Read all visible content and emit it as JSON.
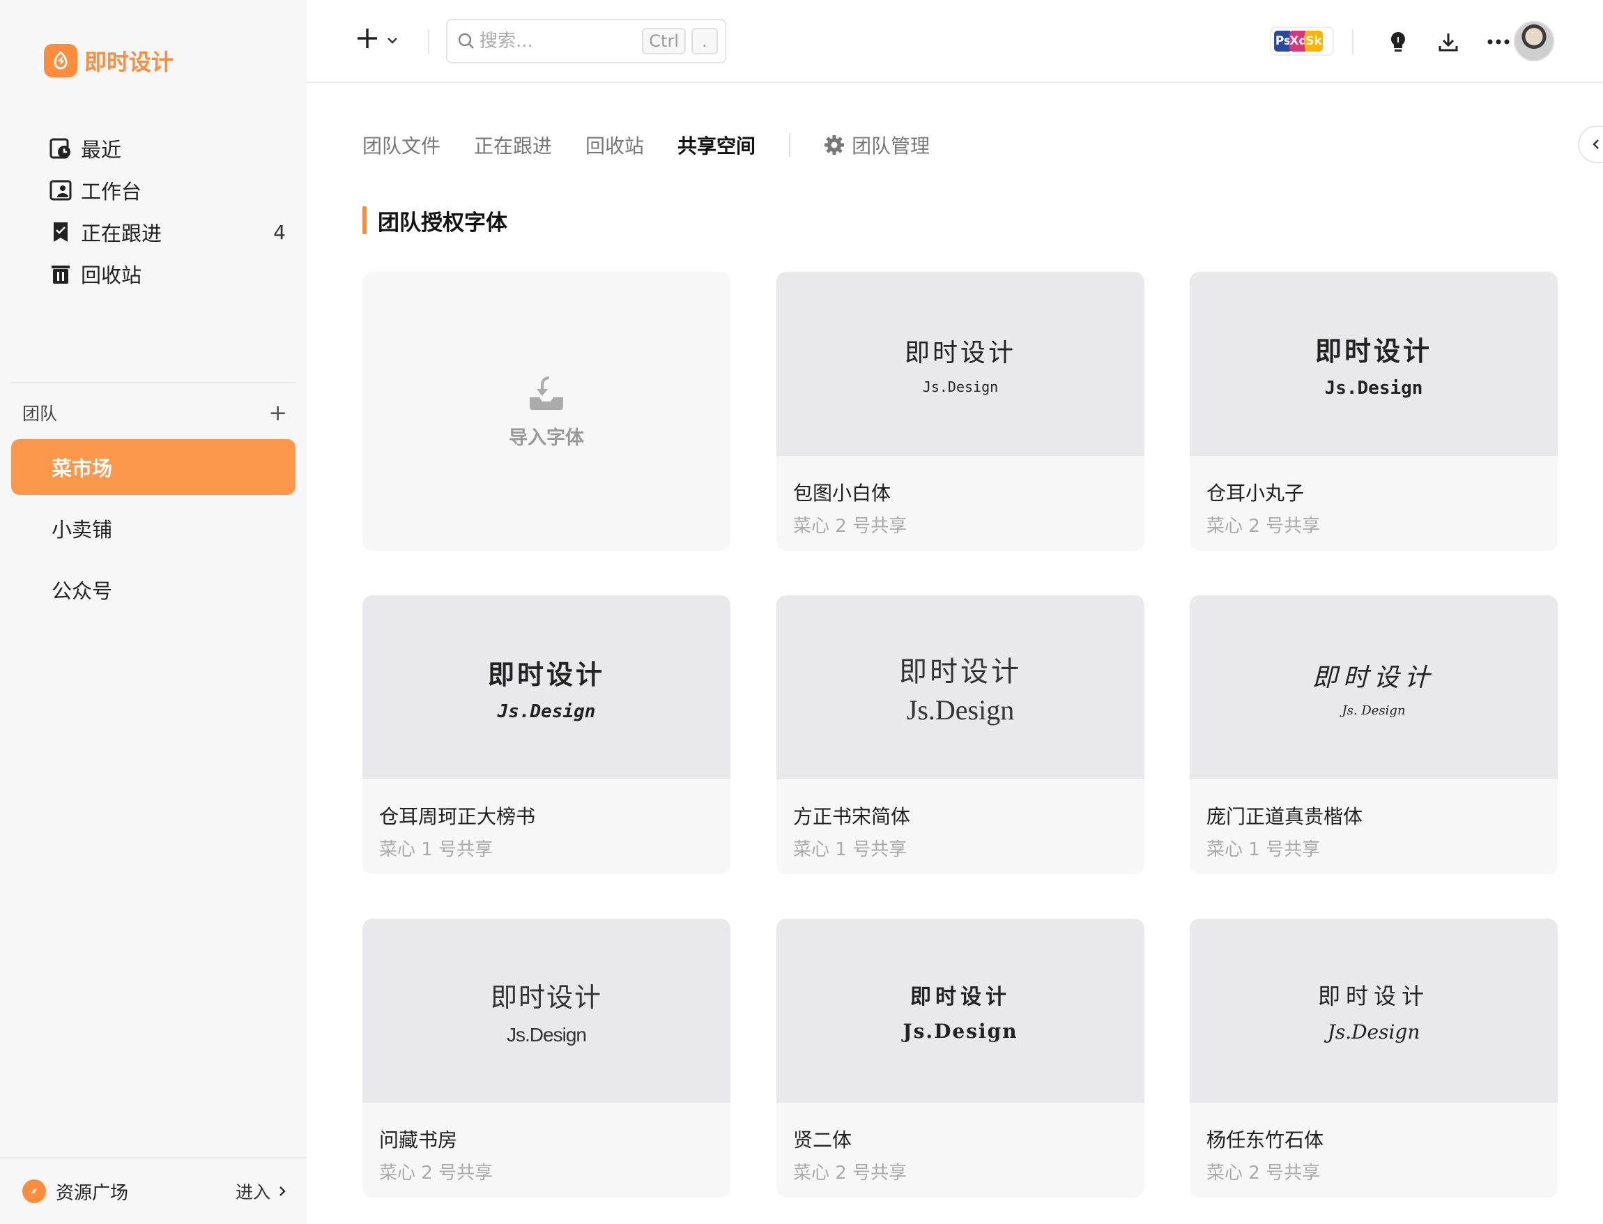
{
  "app": {
    "name": "即时设计"
  },
  "sidebar": {
    "nav": [
      {
        "label": "最近",
        "icon": "clock-icon"
      },
      {
        "label": "工作台",
        "icon": "workspace-icon"
      },
      {
        "label": "正在跟进",
        "icon": "bookmark-icon",
        "count": "4"
      },
      {
        "label": "回收站",
        "icon": "trash-icon"
      }
    ],
    "team_header": "团队",
    "teams": [
      {
        "label": "菜市场",
        "active": true
      },
      {
        "label": "小卖铺",
        "active": false
      },
      {
        "label": "公众号",
        "active": false
      }
    ],
    "footer": {
      "label": "资源广场",
      "enter": "进入"
    }
  },
  "topbar": {
    "search": {
      "placeholder": "搜索...",
      "kbd1": "Ctrl",
      "kbd2": "."
    },
    "apps": [
      "Ps",
      "Xd",
      "Sk"
    ]
  },
  "tabs": [
    {
      "label": "团队文件",
      "active": false
    },
    {
      "label": "正在跟进",
      "active": false
    },
    {
      "label": "回收站",
      "active": false
    },
    {
      "label": "共享空间",
      "active": true
    }
  ],
  "manage_tab": "团队管理",
  "section": {
    "title": "团队授权字体"
  },
  "import_card": {
    "label": "导入字体"
  },
  "fonts": [
    {
      "name": "包图小白体",
      "meta": "菜心 2 号共享",
      "preview_main": "即时设计",
      "preview_sub": "Js.Design"
    },
    {
      "name": "仓耳小丸子",
      "meta": "菜心 2 号共享",
      "preview_main": "即时设计",
      "preview_sub": "Js.Design"
    },
    {
      "name": "仓耳周珂正大榜书",
      "meta": "菜心 1 号共享",
      "preview_main": "即时设计",
      "preview_sub": "Js.Design"
    },
    {
      "name": "方正书宋简体",
      "meta": "菜心 1 号共享",
      "preview_main": "即时设计",
      "preview_sub": "Js.Design"
    },
    {
      "name": "庞门正道真贵楷体",
      "meta": "菜心 1 号共享",
      "preview_main": "即时设计",
      "preview_sub": "Js. Design"
    },
    {
      "name": "问藏书房",
      "meta": "菜心 2 号共享",
      "preview_main": "即时设计",
      "preview_sub": "Js.Design"
    },
    {
      "name": "贤二体",
      "meta": "菜心 2 号共享",
      "preview_main": "即时设计",
      "preview_sub": "Js.Design"
    },
    {
      "name": "杨任东竹石体",
      "meta": "菜心 2 号共享",
      "preview_main": "即时设计",
      "preview_sub": "Js.Design"
    }
  ],
  "colors": {
    "accent": "#fd8d3c",
    "active_team_bg": "#fd974c"
  }
}
